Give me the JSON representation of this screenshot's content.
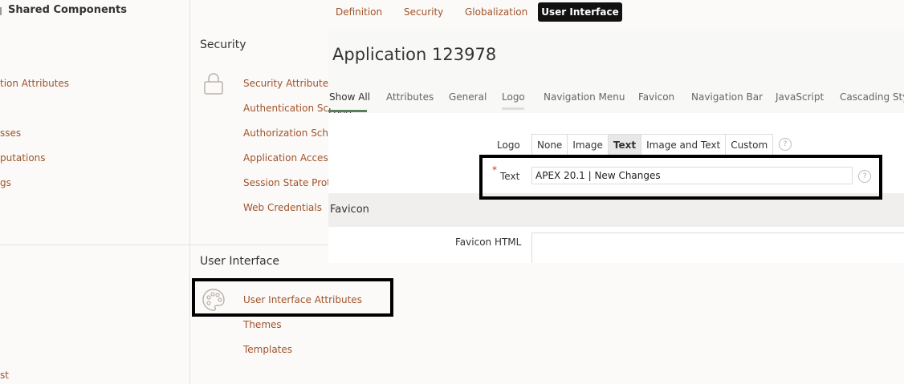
{
  "left": {
    "title": "Shared Components",
    "items": [
      "tion Attributes",
      "sses",
      "putations",
      "gs"
    ],
    "bottom_text": "st"
  },
  "top_tabs": {
    "items": [
      "Definition",
      "Security",
      "Globalization"
    ],
    "active": "User Interface"
  },
  "security": {
    "title": "Security",
    "links": [
      "Security Attributes",
      "Authentication Sch",
      "Authorization Sche",
      "Application Access",
      "Session State Prote",
      "Web Credentials"
    ]
  },
  "user_interface": {
    "title": "User Interface",
    "links": [
      "User Interface Attributes",
      "Themes",
      "Templates"
    ]
  },
  "panel": {
    "app_title": "Application 123978",
    "tabs": [
      "Show All",
      "Attributes",
      "General",
      "Logo",
      "Navigation Menu",
      "Favicon",
      "Navigation Bar",
      "JavaScript",
      "Cascading Style"
    ],
    "active_tab": "Show All",
    "logo_section_clip": "Logo",
    "logo_label": "Logo",
    "logo_options": [
      "None",
      "Image",
      "Text",
      "Image and Text",
      "Custom"
    ],
    "logo_selected": "Text",
    "text_label": "Text",
    "required_mark": "*",
    "text_value": "APEX 20.1 | New Changes",
    "favicon_title": "Favicon",
    "favicon_html_label": "Favicon HTML",
    "help_glyph": "?"
  },
  "colors": {
    "link": "#a0532b",
    "active_tab_bg": "#111111",
    "tab_underline": "#5b7e5a",
    "highlight": "#000000"
  }
}
